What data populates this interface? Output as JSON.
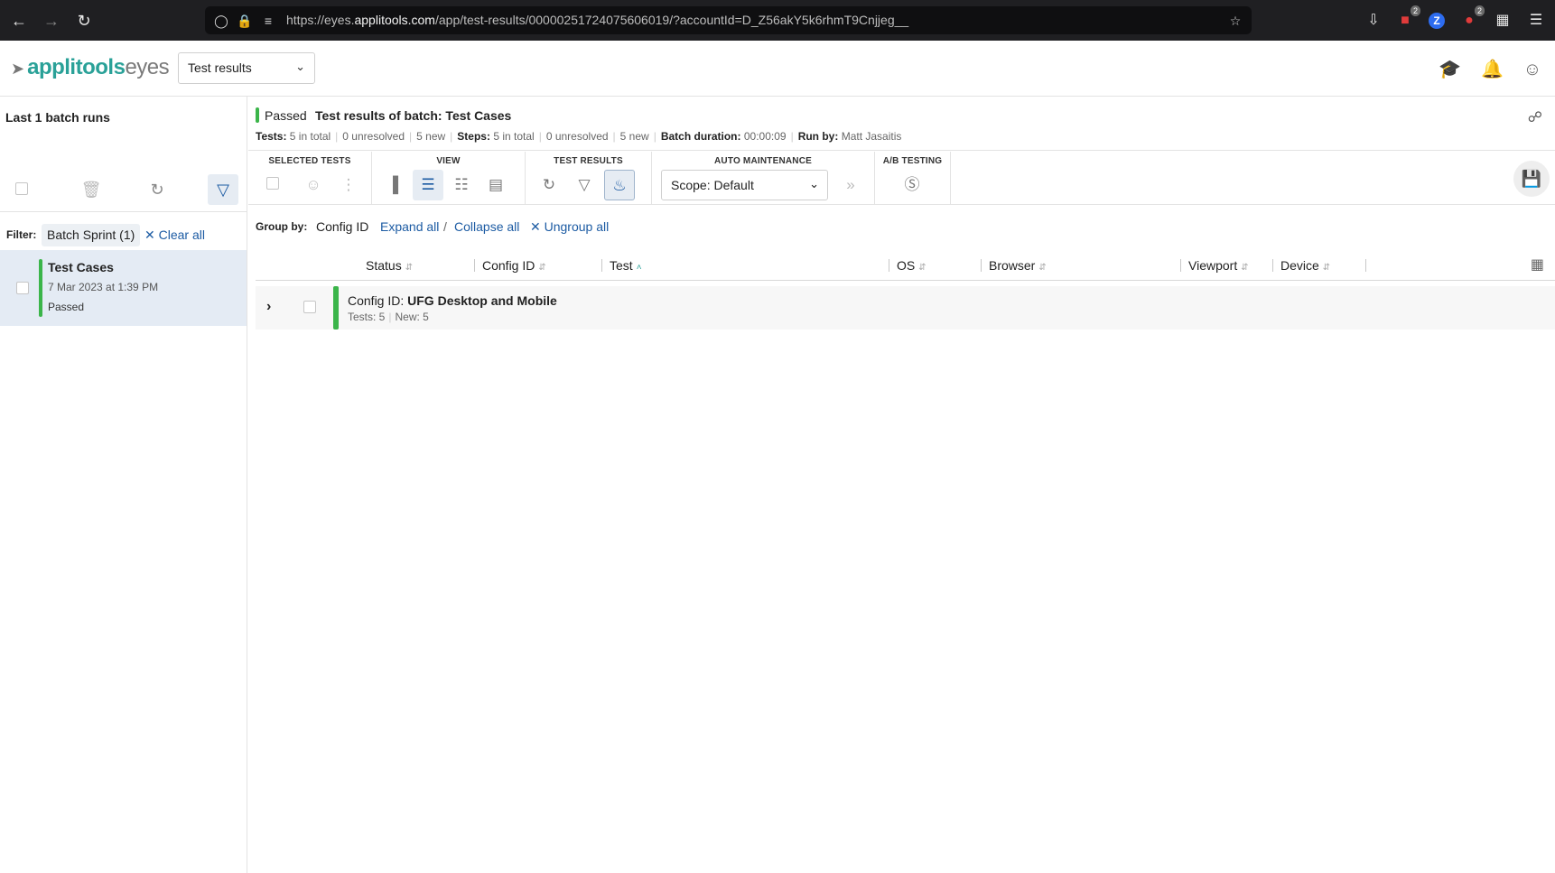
{
  "browser": {
    "url_prefix": "https://eyes.",
    "url_domain": "applitools.com",
    "url_path": "/app/test-results/00000251724075606019/?accountId=D_Z56akY5k6rhmT9Cnjjeg__",
    "ext_badge_1": "2",
    "ext_badge_2": "2",
    "ext_z": "Z"
  },
  "app": {
    "logo_main": "applitools",
    "logo_sub": "eyes",
    "page_selector": "Test results"
  },
  "sidebar": {
    "title": "Last 1 batch runs",
    "filter_label": "Filter:",
    "filter_chip": "Batch Sprint (1)",
    "clear_all": "✕ Clear all",
    "batch": {
      "name": "Test Cases",
      "date": "7 Mar 2023 at 1:39 PM",
      "status": "Passed"
    }
  },
  "batch_header": {
    "status": "Passed",
    "title": "Test results of batch: Test Cases",
    "tests_label": "Tests:",
    "tests_total": "5 in total",
    "tests_unresolved": "0 unresolved",
    "tests_new": "5 new",
    "steps_label": "Steps:",
    "steps_total": "5 in total",
    "steps_unresolved": "0 unresolved",
    "steps_new": "5 new",
    "duration_label": "Batch duration:",
    "duration": "00:00:09",
    "runby_label": "Run by:",
    "runby": "Matt Jasaitis"
  },
  "toolbar": {
    "selected_tests": "SELECTED TESTS",
    "view": "VIEW",
    "test_results": "TEST RESULTS",
    "auto_maintenance": "AUTO MAINTENANCE",
    "ab_testing": "A/B TESTING",
    "scope": "Scope: Default"
  },
  "group_by": {
    "label": "Group by:",
    "value": "Config ID",
    "expand_all": "Expand all",
    "collapse_all": "Collapse all",
    "ungroup_all": "✕ Ungroup all"
  },
  "columns": [
    "Status",
    "Config ID",
    "Test",
    "OS",
    "Browser",
    "Viewport",
    "Device"
  ],
  "group_row": {
    "prefix": "Config ID:",
    "name": "UFG Desktop and Mobile",
    "tests": "Tests: 5",
    "new": "New: 5"
  },
  "colors": {
    "passed": "#3bb54a",
    "link": "#1c5ba3",
    "brand": "#2aa198"
  }
}
